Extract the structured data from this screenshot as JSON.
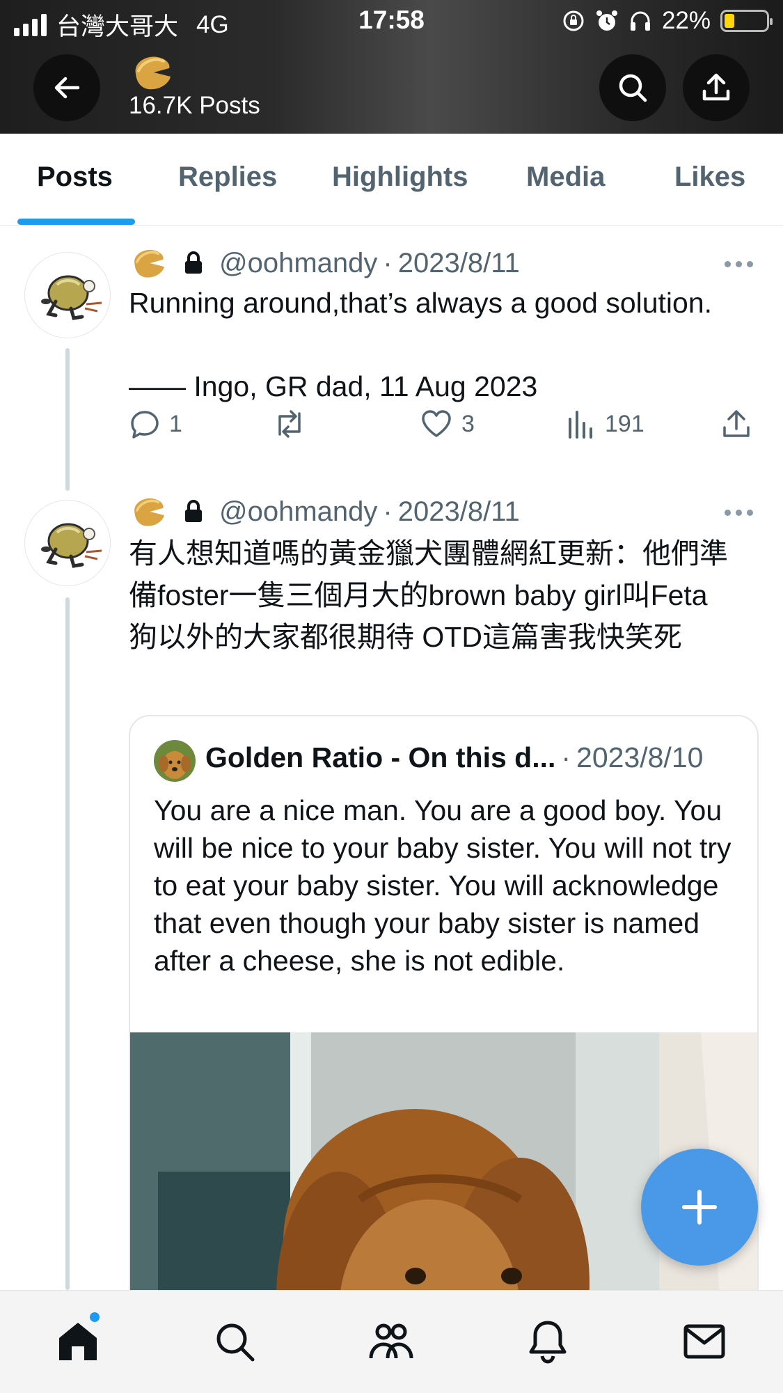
{
  "status_bar": {
    "carrier": "台灣大哥大",
    "network": "4G",
    "time": "17:58",
    "battery": "22%"
  },
  "header": {
    "post_count": "16.7K Posts",
    "back_icon": "arrow-left-icon",
    "search_icon": "search-icon",
    "share_icon": "share-icon"
  },
  "tabs": [
    "Posts",
    "Replies",
    "Highlights",
    "Media",
    "Likes"
  ],
  "active_tab": "Posts",
  "posts": [
    {
      "handle": "@oohmandy",
      "separator": "·",
      "date": "2023/8/11",
      "text": "Running around,that’s always a good solution.\n\n—— Ingo, GR dad, 11 Aug 2023",
      "replies": "1",
      "reposts": "",
      "likes": "3",
      "views": "191"
    },
    {
      "handle": "@oohmandy",
      "separator": "·",
      "date": "2023/8/11",
      "text": "有人想知道嗎的黃金獵犬團體網紅更新：他們準備foster一隻三個月大的brown baby girl叫Feta 狗以外的大家都很期待 OTD這篇害我快笑死",
      "quote": {
        "name": "Golden Ratio - On this d...",
        "separator": "·",
        "date": "2023/8/10",
        "text": "You are a nice man. You are a good boy. You will be nice to your baby sister. You will not try to eat your baby sister. You will acknowledge that even though your baby sister is named after a cheese, she is not edible."
      }
    }
  ],
  "bottom_nav": [
    "home-icon",
    "search-icon",
    "communities-icon",
    "notifications-icon",
    "messages-icon"
  ],
  "colors": {
    "accent": "#1d9bf0",
    "fab": "#4a99e9",
    "muted_text": "#536471",
    "primary_text": "#0f1419"
  }
}
